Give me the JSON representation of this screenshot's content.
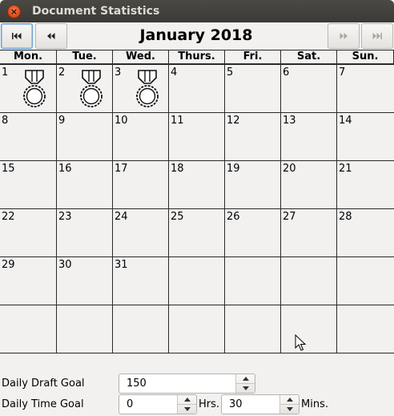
{
  "window": {
    "title": "Document Statistics",
    "close_glyph": "×"
  },
  "nav": {
    "month_title": "January 2018",
    "buttons": [
      {
        "name": "first",
        "icon": "skip-to-start-icon"
      },
      {
        "name": "prev",
        "icon": "rewind-icon"
      },
      {
        "name": "next",
        "icon": "fast-forward-icon"
      },
      {
        "name": "last",
        "icon": "skip-to-end-icon"
      }
    ]
  },
  "weekdays": [
    "Mon.",
    "Tue.",
    "Wed.",
    "Thurs.",
    "Fri.",
    "Sat.",
    "Sun."
  ],
  "weeks": [
    [
      {
        "day": "1",
        "medal": true
      },
      {
        "day": "2",
        "medal": true
      },
      {
        "day": "3",
        "medal": true
      },
      {
        "day": "4"
      },
      {
        "day": "5"
      },
      {
        "day": "6"
      },
      {
        "day": "7"
      }
    ],
    [
      {
        "day": "8"
      },
      {
        "day": "9"
      },
      {
        "day": "10"
      },
      {
        "day": "11"
      },
      {
        "day": "12"
      },
      {
        "day": "13"
      },
      {
        "day": "14"
      }
    ],
    [
      {
        "day": "15"
      },
      {
        "day": "16"
      },
      {
        "day": "17"
      },
      {
        "day": "18"
      },
      {
        "day": "19"
      },
      {
        "day": "20"
      },
      {
        "day": "21"
      }
    ],
    [
      {
        "day": "22"
      },
      {
        "day": "23"
      },
      {
        "day": "24"
      },
      {
        "day": "25"
      },
      {
        "day": "26"
      },
      {
        "day": "27"
      },
      {
        "day": "28"
      }
    ],
    [
      {
        "day": "29"
      },
      {
        "day": "30"
      },
      {
        "day": "31"
      },
      {
        "day": ""
      },
      {
        "day": ""
      },
      {
        "day": ""
      },
      {
        "day": ""
      }
    ],
    [
      {
        "day": ""
      },
      {
        "day": ""
      },
      {
        "day": ""
      },
      {
        "day": ""
      },
      {
        "day": ""
      },
      {
        "day": ""
      },
      {
        "day": ""
      }
    ]
  ],
  "form": {
    "draft_goal": {
      "label": "Daily Draft Goal",
      "value": "150"
    },
    "time_goal": {
      "label": "Daily Time Goal",
      "hours_value": "0",
      "hours_unit": "Hrs.",
      "minutes_value": "30",
      "minutes_unit": "Mins."
    }
  },
  "colors": {
    "close_button": "#dd4814",
    "titlebar": "#3c3b37",
    "background": "#f2f1f0",
    "focus": "#6f9fd1"
  }
}
